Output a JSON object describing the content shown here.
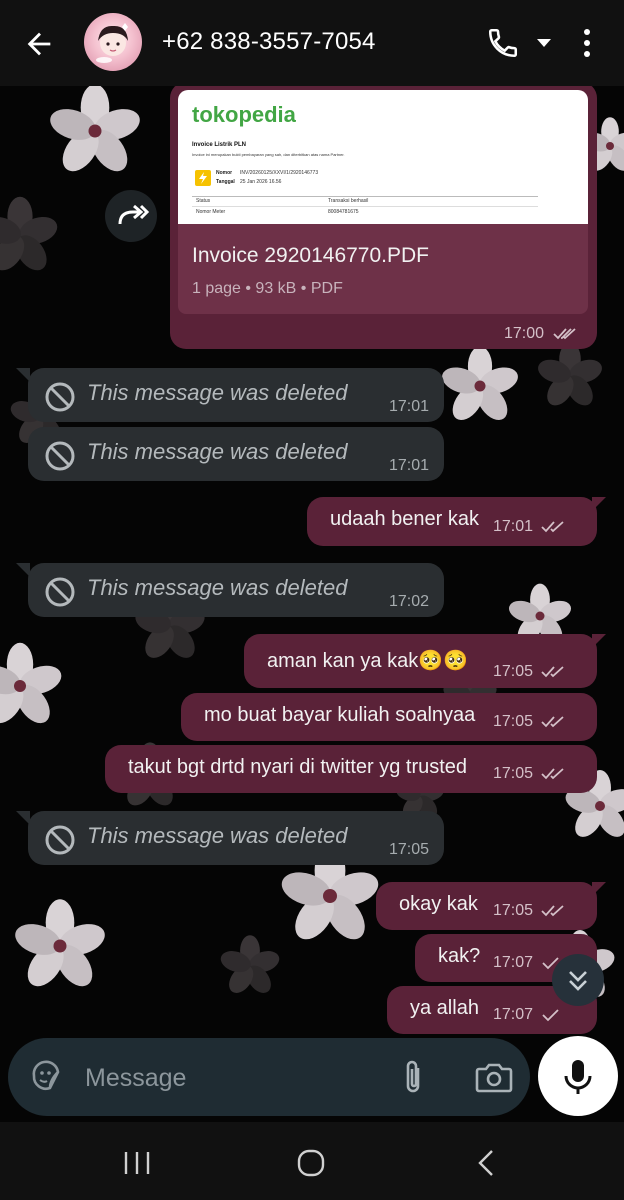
{
  "header": {
    "contact_name": "+62 838-3557-7054",
    "icons": [
      "arrow-left-icon",
      "avatar",
      "phone-icon",
      "caret-down-icon",
      "more-vertical-icon"
    ]
  },
  "document": {
    "preview_brand": "tokopedia",
    "preview_heading": "Invoice Listrik PLN",
    "preview_sub": "Invoice ini merupakan bukti pembayaran yang sah, dan diterbitkan atas nama Partner.",
    "preview_nomor_label": "Nomor",
    "preview_nomor": "INV/20260125/XXVI/1/2920146773",
    "preview_tanggal_label": "Tanggal",
    "preview_tanggal": "25 Jan 2026 16.56",
    "preview_status_label": "Status",
    "preview_status": "Transaksi berhasil",
    "preview_meter_label": "Nomor Meter",
    "preview_meter": "80084781675",
    "filename": "Invoice 2920146770.PDF",
    "meta": "1 page • 93 kB • PDF",
    "time": "17:00"
  },
  "messages": [
    {
      "type": "deleted",
      "text": "This message was deleted",
      "time": "17:01"
    },
    {
      "type": "deleted",
      "text": "This message was deleted",
      "time": "17:01"
    },
    {
      "type": "out",
      "text": "udaah bener kak",
      "time": "17:01"
    },
    {
      "type": "deleted",
      "text": "This message was deleted",
      "time": "17:02"
    },
    {
      "type": "out",
      "text": "aman kan ya kak🥺🥺",
      "time": "17:05"
    },
    {
      "type": "out",
      "text": "mo buat bayar kuliah soalnyaa",
      "time": "17:05"
    },
    {
      "type": "out",
      "text": "takut bgt drtd nyari di twitter yg trusted",
      "time": "17:05"
    },
    {
      "type": "deleted",
      "text": "This message was deleted",
      "time": "17:05"
    },
    {
      "type": "out",
      "text": "okay kak",
      "time": "17:05"
    },
    {
      "type": "out",
      "text": "kak?",
      "time": "17:07"
    },
    {
      "type": "out",
      "text": "ya allah",
      "time": "17:07"
    }
  ],
  "composer": {
    "placeholder": "Message",
    "icons": [
      "sticker-icon",
      "attach-icon",
      "camera-icon",
      "mic-icon"
    ]
  },
  "nav": {
    "icons": [
      "recents-icon",
      "home-icon",
      "back-icon"
    ]
  },
  "colors": {
    "outgoing_bubble": "#5a2238",
    "incoming_bubble": "#2a2e31",
    "header": "#111111"
  }
}
